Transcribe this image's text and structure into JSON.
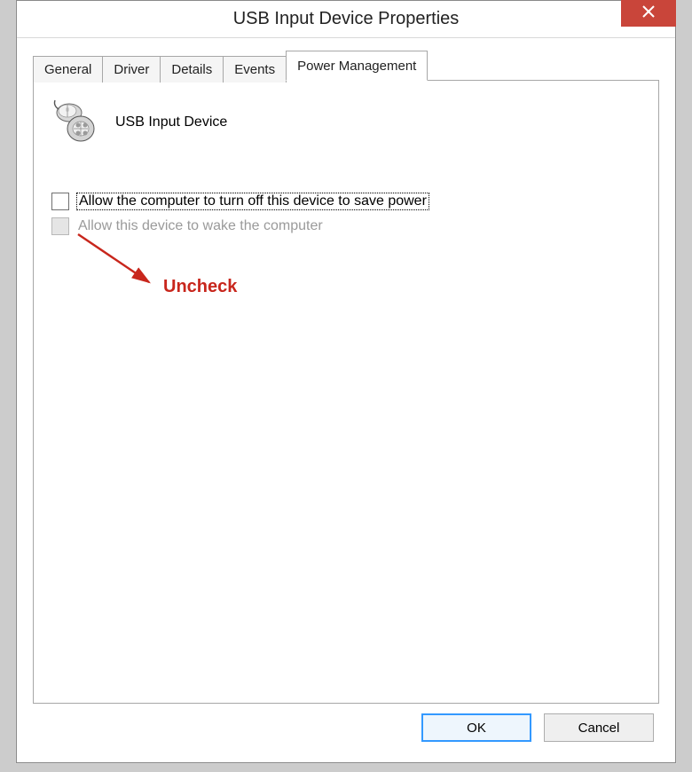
{
  "window": {
    "title": "USB Input Device Properties"
  },
  "tabs": [
    {
      "label": "General"
    },
    {
      "label": "Driver"
    },
    {
      "label": "Details"
    },
    {
      "label": "Events"
    },
    {
      "label": "Power Management",
      "active": true
    }
  ],
  "device": {
    "name": "USB Input Device"
  },
  "options": {
    "turn_off_label": "Allow the computer to turn off this device to save power",
    "wake_label": "Allow this device to wake the computer"
  },
  "annotation": {
    "text": "Uncheck"
  },
  "buttons": {
    "ok": "OK",
    "cancel": "Cancel"
  }
}
